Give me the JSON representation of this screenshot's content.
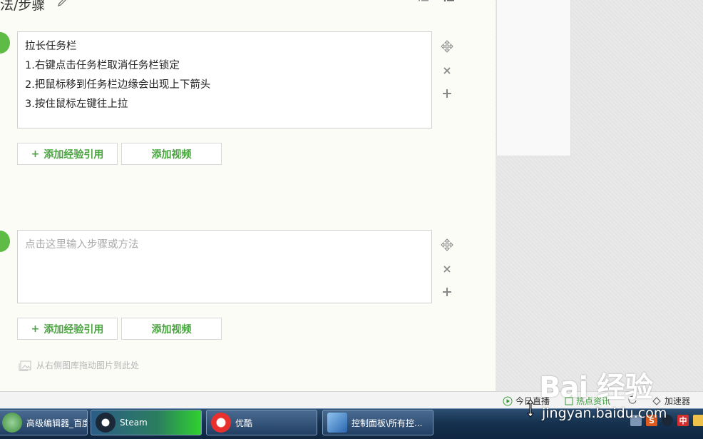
{
  "section": {
    "title": "法/步骤"
  },
  "steps": [
    {
      "lines": [
        "拉长任务栏",
        "1.右键点击任务栏取消任务栏锁定",
        "2.把鼠标移到任务栏边缘会出现上下箭头",
        "3.按住鼠标左键往上拉"
      ],
      "buttons": {
        "add_ref": "添加经验引用",
        "add_video": "添加视频"
      }
    },
    {
      "placeholder": "点击这里输入步骤或方法",
      "buttons": {
        "add_ref": "添加经验引用",
        "add_video": "添加视频"
      }
    }
  ],
  "drag_hint": "从右侧图库拖动图片到此处",
  "statusbar": {
    "today_live": "今日直播",
    "hot_news": "热点资讯",
    "accelerator": "加速器"
  },
  "watermark": {
    "main": "Bai 经验",
    "sub": "jingyan.baidu.com"
  },
  "taskbar": {
    "tasks": [
      "高级编辑器_百度...",
      "Steam",
      "优酷",
      "控制面板\\所有控..."
    ],
    "tray": [
      "S",
      "中"
    ]
  },
  "colors": {
    "accent_green": "#5dbb46",
    "button_text": "#4aa340"
  }
}
